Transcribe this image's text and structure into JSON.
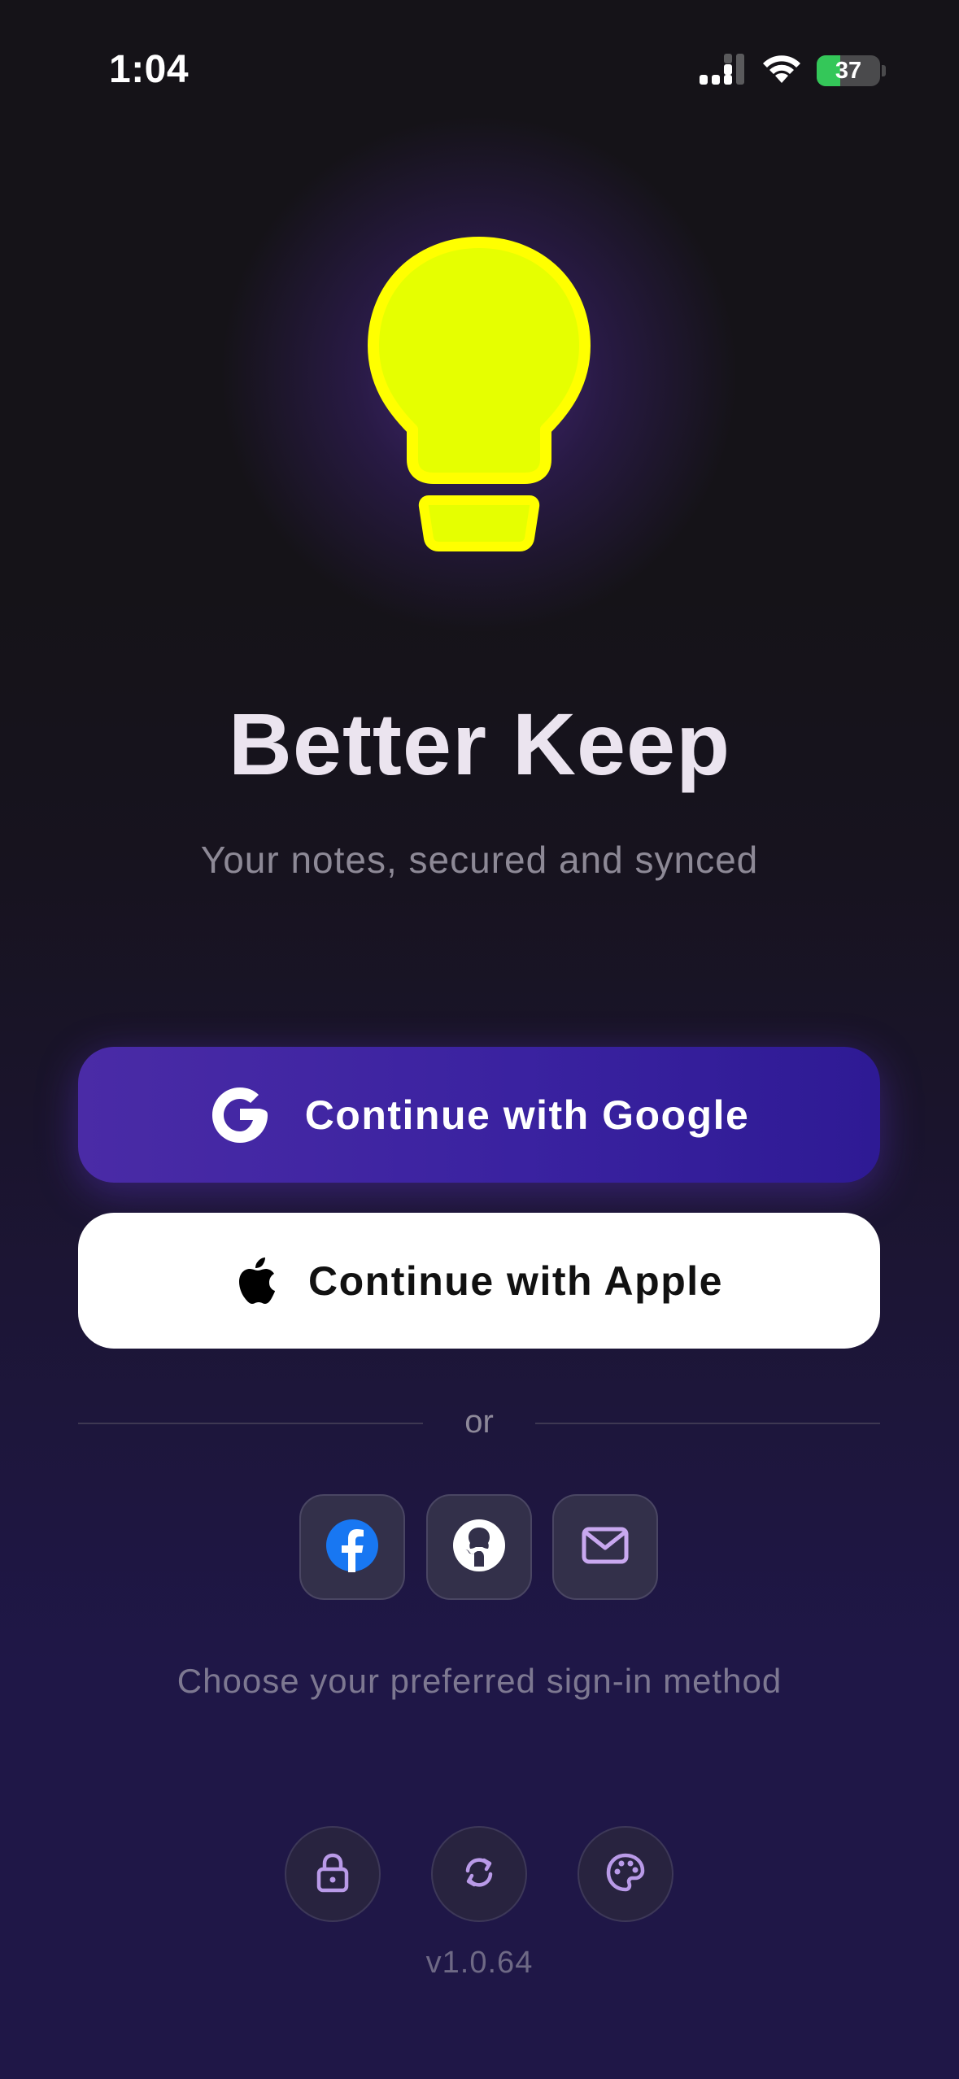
{
  "status_bar": {
    "time": "1:04",
    "battery_level": 37,
    "battery_label": "37",
    "icons": [
      "signal-icon",
      "wifi-icon",
      "battery-charging-icon"
    ]
  },
  "hero": {
    "icon": "lightbulb-icon",
    "app_title": "Better Keep",
    "subtitle": "Your notes, secured and synced"
  },
  "auth": {
    "google": {
      "label": "Continue with Google",
      "icon": "google-icon"
    },
    "apple": {
      "label": "Continue with Apple",
      "icon": "apple-icon"
    },
    "divider_text": "or",
    "alternatives": [
      {
        "name": "facebook",
        "icon": "facebook-icon"
      },
      {
        "name": "github",
        "icon": "github-icon"
      },
      {
        "name": "email",
        "icon": "mail-icon"
      }
    ],
    "hint": "Choose your preferred sign-in method"
  },
  "features": [
    {
      "name": "security",
      "icon": "lock-icon"
    },
    {
      "name": "sync",
      "icon": "sync-icon"
    },
    {
      "name": "themes",
      "icon": "palette-icon"
    }
  ],
  "footer": {
    "version": "v1.0.64"
  },
  "colors": {
    "background_top": "#151318",
    "background_bottom": "#1f1747",
    "google_button": "#3a22a0",
    "apple_button": "#ffffff",
    "bulb": "#e6ff00",
    "bulb_outline": "#ffff00",
    "battery_fill": "#34c759",
    "facebook_blue": "#1877f2",
    "accent_lavender": "#c9a8f0"
  }
}
